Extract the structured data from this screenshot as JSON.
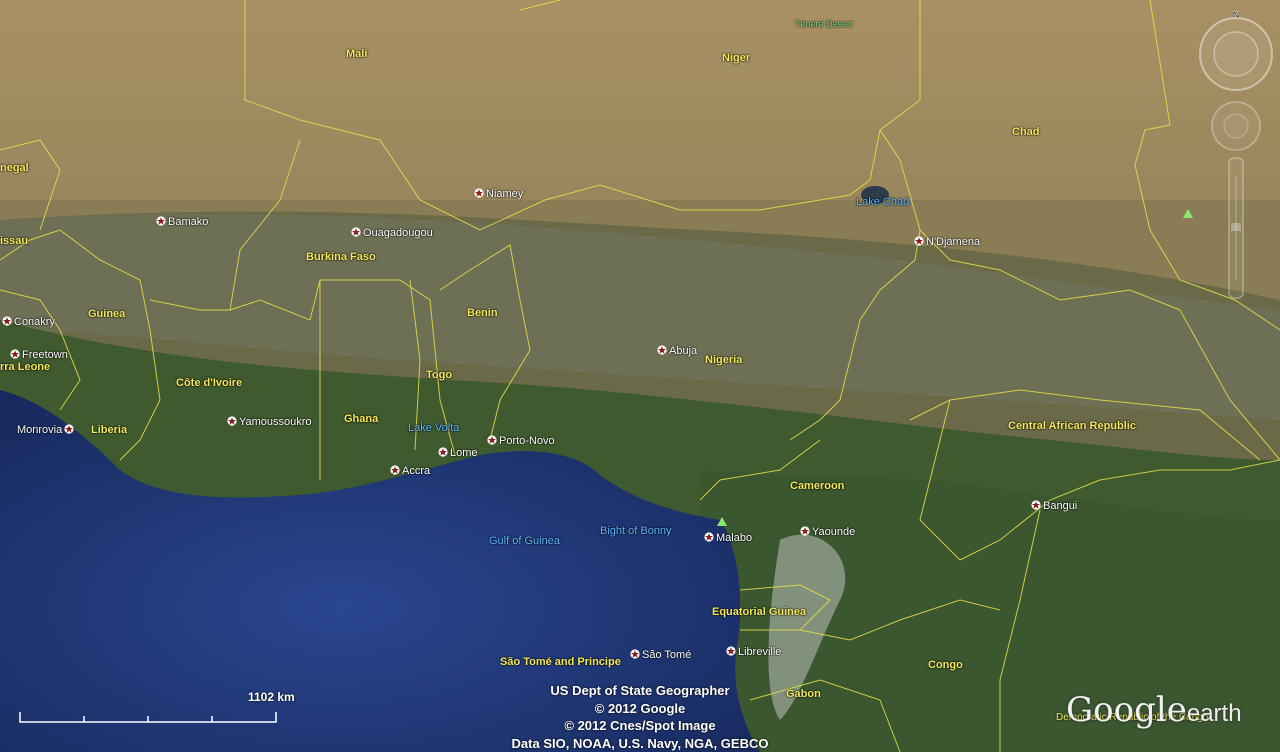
{
  "map": {
    "countries": [
      {
        "name": "Mali"
      },
      {
        "name": "Niger"
      },
      {
        "name": "Chad"
      },
      {
        "name": "negal"
      },
      {
        "name": "issau"
      },
      {
        "name": "Burkina Faso"
      },
      {
        "name": "Guinea"
      },
      {
        "name": "Benin"
      },
      {
        "name": "Nigeria"
      },
      {
        "name": "rra Leone"
      },
      {
        "name": "Côte d'Ivoire"
      },
      {
        "name": "Togo"
      },
      {
        "name": "Ghana"
      },
      {
        "name": "Liberia"
      },
      {
        "name": "Central African Republic"
      },
      {
        "name": "Cameroon"
      },
      {
        "name": "Equatorial Guinea"
      },
      {
        "name": "São Tomé and Principe"
      },
      {
        "name": "Gabon"
      },
      {
        "name": "Congo"
      }
    ],
    "water": [
      {
        "name": "Lake Chad"
      },
      {
        "name": "Lake Volta"
      },
      {
        "name": "Gulf of Guinea"
      },
      {
        "name": "Bight of Bonny"
      }
    ],
    "deserts": [
      {
        "name": "Ténéré Desert"
      }
    ],
    "cities": [
      {
        "name": "Niamey"
      },
      {
        "name": "Bamako"
      },
      {
        "name": "Ouagadougou"
      },
      {
        "name": "N'Djamena"
      },
      {
        "name": "Conakry"
      },
      {
        "name": "Freetown"
      },
      {
        "name": "Abuja"
      },
      {
        "name": "Yamoussoukro"
      },
      {
        "name": "Monrovia"
      },
      {
        "name": "Porto-Novo"
      },
      {
        "name": "Lome"
      },
      {
        "name": "Accra"
      },
      {
        "name": "Bangui"
      },
      {
        "name": "Malabo"
      },
      {
        "name": "Yaounde"
      },
      {
        "name": "Libreville"
      },
      {
        "name": "São Tomé"
      }
    ]
  },
  "scale": {
    "label": "1102 km"
  },
  "attribution": [
    "US Dept of State Geographer",
    "© 2012 Google",
    "© 2012 Cnes/Spot Image",
    "Data SIO, NOAA, U.S. Navy, NGA, GEBCO"
  ],
  "logo": {
    "google": "Google",
    "earth": "earth"
  },
  "demo_text": "Democratic Republic of the Congo",
  "nav": {
    "north": "N"
  },
  "colors": {
    "border": "#e8e04a",
    "country_label": "#f4e85a",
    "water_label": "#5fb8ff",
    "ocean": "#1e3570"
  }
}
